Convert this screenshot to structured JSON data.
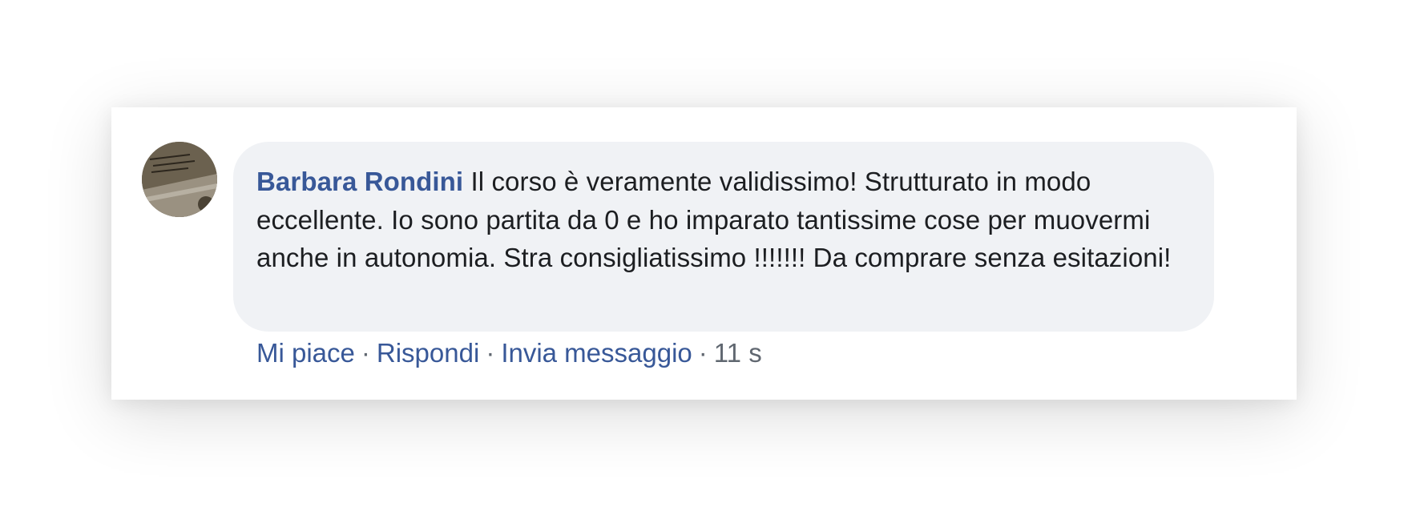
{
  "comment": {
    "author": "Barbara Rondini",
    "text": "Il corso è veramente validissimo! Strutturato in modo eccellente. Io sono partita da 0 e ho imparato tantissime cose per muovermi anche in autonomia. Stra consigliatissimo !!!!!!! Da comprare senza esitazioni!"
  },
  "actions": {
    "like": "Mi piace",
    "reply": "Rispondi",
    "message": "Invia messaggio",
    "separator": "·",
    "timestamp": "11 s"
  },
  "colors": {
    "link": "#385898",
    "text": "#1c1e21",
    "meta": "#606770",
    "bubble": "#f0f2f5"
  }
}
